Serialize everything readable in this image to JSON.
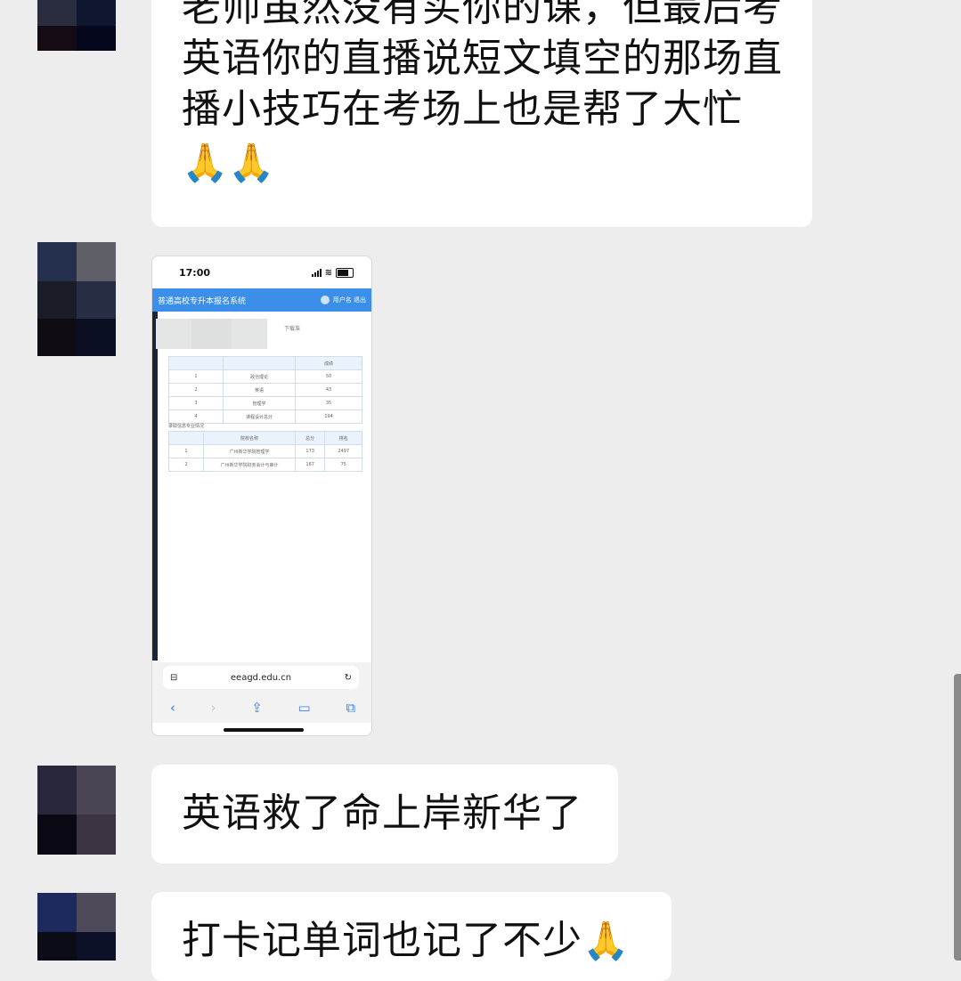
{
  "messages": [
    {
      "line1": "老师虽然没有买你的课，但最后考",
      "line2": "英语你的直播说短文填空的那场直",
      "line3": "播小技巧在考场上也是帮了大忙",
      "emoji": "🙏🙏"
    },
    {
      "screenshot": {
        "status_time": "17:00",
        "site_title": "普通高校专升本报名系统",
        "user_info": "用户名  退出",
        "subtitle": "下载准",
        "score_header": "成绩",
        "scores": [
          {
            "no": "1",
            "subject": "政治理论",
            "score": "50"
          },
          {
            "no": "2",
            "subject": "英语",
            "score": "43"
          },
          {
            "no": "3",
            "subject": "管理学",
            "score": "35"
          },
          {
            "no": "4",
            "subject": "课程设计总分",
            "score": "194"
          }
        ],
        "section_label": "录取信息专业情况",
        "rank_headers": [
          "院校名称",
          "总分",
          "排名"
        ],
        "ranks": [
          {
            "no": "1",
            "school": "广州新华学院管理学",
            "total": "173",
            "rank": "2497"
          },
          {
            "no": "2",
            "school": "广州新华学院财务会计与审计",
            "total": "167",
            "rank": "75"
          }
        ],
        "url": "eeagd.edu.cn"
      }
    },
    {
      "text": "英语救了命上岸新华了"
    },
    {
      "text": "打卡记单词也记了不少",
      "emoji": "🙏"
    }
  ]
}
